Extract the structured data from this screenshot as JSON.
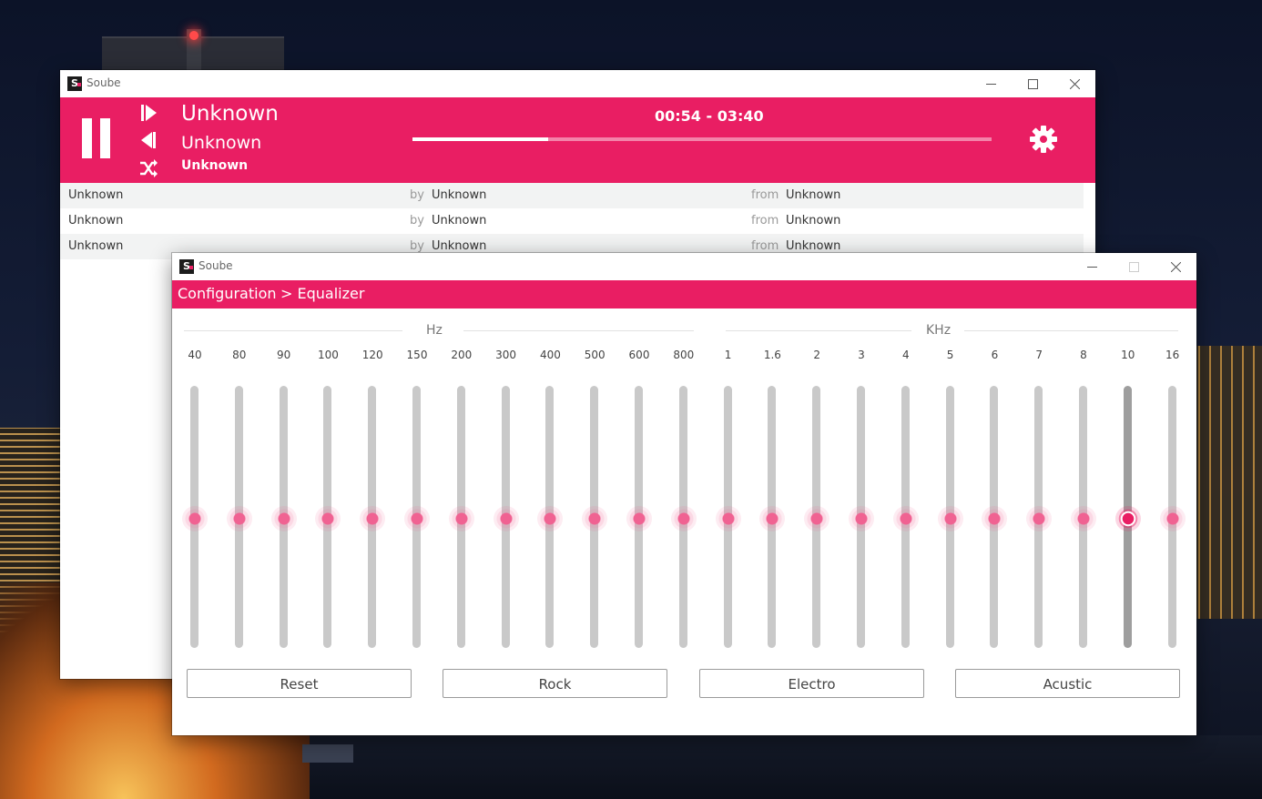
{
  "player_window": {
    "title": "Soube",
    "now_playing": {
      "title": "Unknown",
      "artist": "Unknown",
      "album": "Unknown"
    },
    "time": "00:54 - 03:40",
    "progress": 0.235,
    "icons": [
      "pause-icon",
      "next-icon",
      "previous-icon",
      "shuffle-icon",
      "settings-icon"
    ],
    "tracks": [
      {
        "title": "Unknown",
        "by": "by",
        "artist": "Unknown",
        "from": "from",
        "album": "Unknown"
      },
      {
        "title": "Unknown",
        "by": "by",
        "artist": "Unknown",
        "from": "from",
        "album": "Unknown"
      },
      {
        "title": "Unknown",
        "by": "by",
        "artist": "Unknown",
        "from": "from",
        "album": "Unknown"
      }
    ]
  },
  "eq_window": {
    "title": "Soube",
    "breadcrumb": [
      "Configuration",
      "> Equalizer"
    ],
    "groups": [
      "Hz",
      "KHz"
    ],
    "bands": [
      "40",
      "80",
      "90",
      "100",
      "120",
      "150",
      "200",
      "300",
      "400",
      "500",
      "600",
      "800",
      "1",
      "1.6",
      "2",
      "3",
      "4",
      "5",
      "6",
      "7",
      "8",
      "10",
      "16"
    ],
    "band_values": [
      0,
      0,
      0,
      0,
      0,
      0,
      0,
      0,
      0,
      0,
      0,
      0,
      0,
      0,
      0,
      0,
      0,
      0,
      0,
      0,
      0,
      0,
      0
    ],
    "focused_band": "10",
    "presets": [
      "Reset",
      "Rock",
      "Electro",
      "Acustic"
    ]
  },
  "colors": {
    "accent": "#e91e63",
    "thumb": "#f06292",
    "track": "#c9c9c9"
  }
}
